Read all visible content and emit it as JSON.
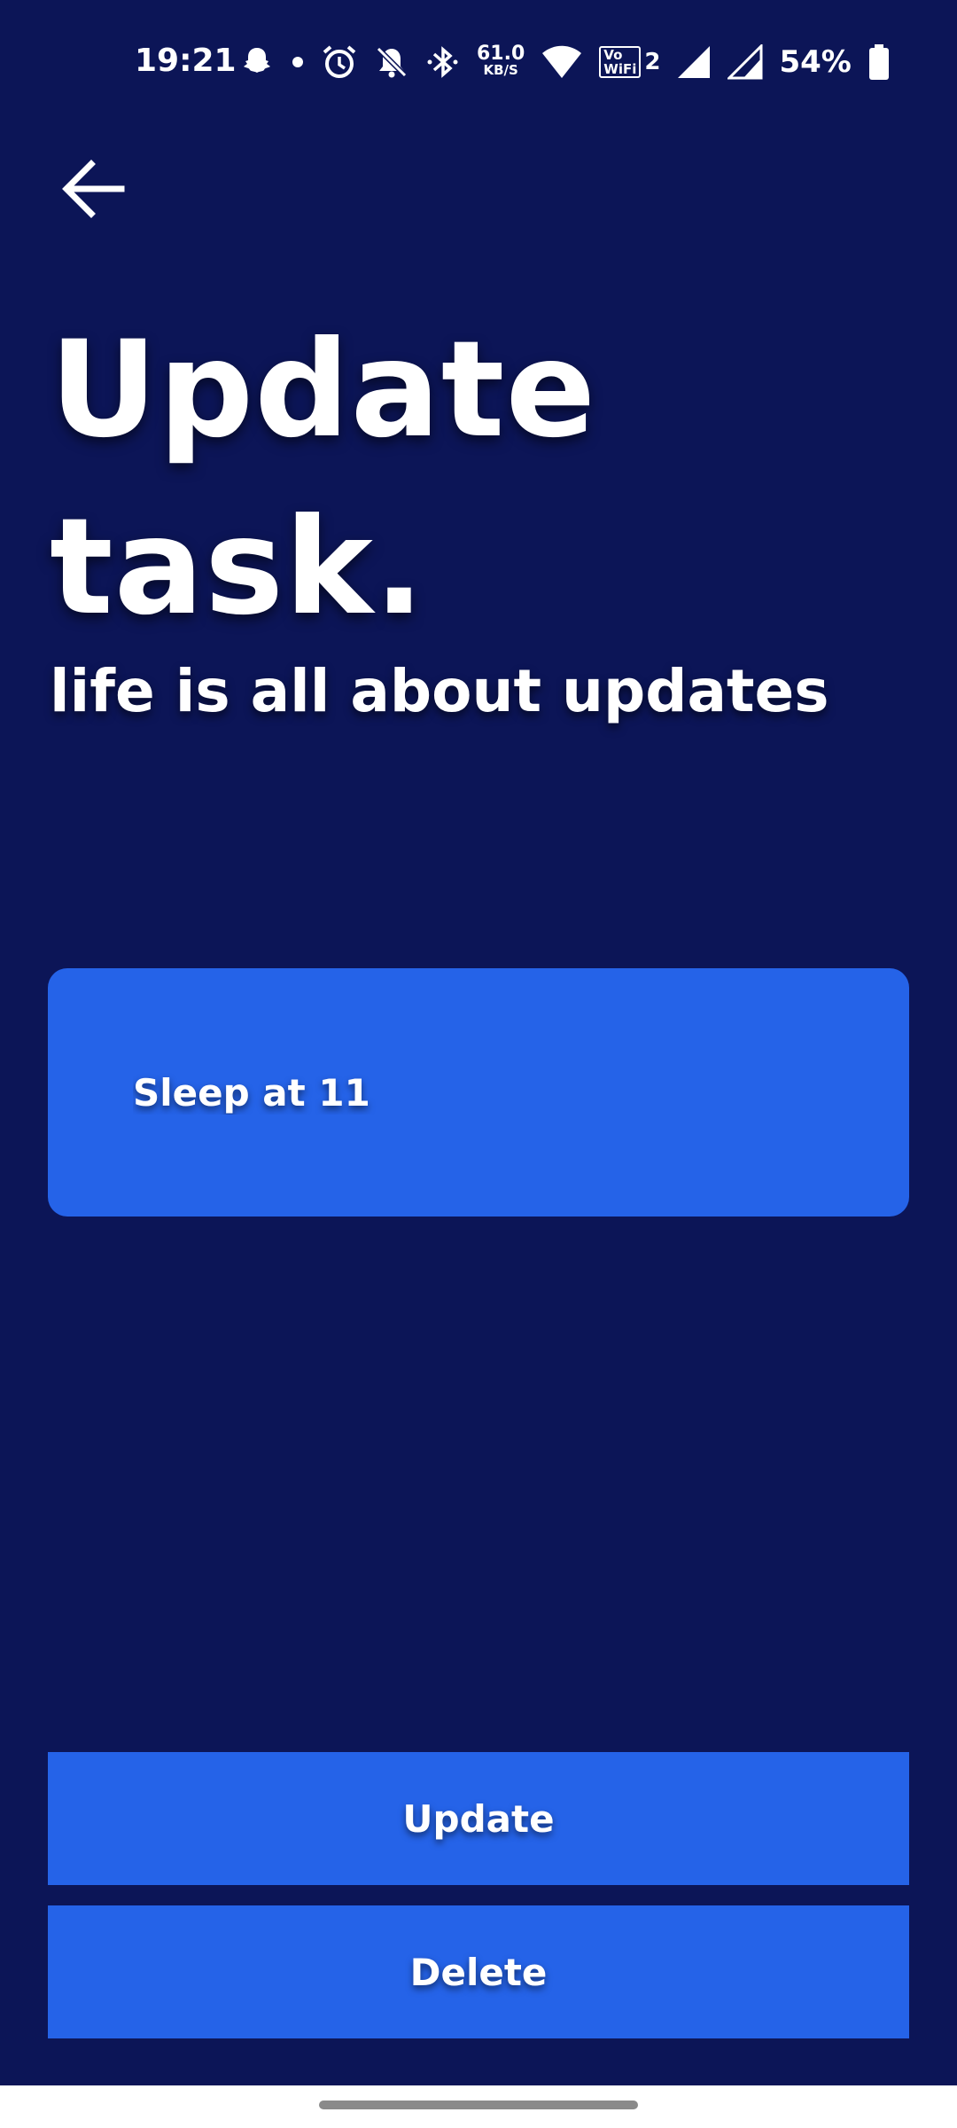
{
  "status_bar": {
    "time": "19:21",
    "net_speed_value": "61.0",
    "net_speed_unit": "KB/S",
    "vowifi_top": "Vo",
    "vowifi_bottom": "WiFi",
    "vowifi_sim": "2",
    "battery_percent": "54%",
    "icons": [
      "snapchat-icon",
      "dot-icon",
      "alarm-icon",
      "bell-off-icon",
      "bluetooth-icon",
      "wifi-icon",
      "vowifi-icon",
      "signal-icon",
      "signal-icon-2",
      "battery-icon"
    ]
  },
  "header": {
    "back_icon": "arrow-left-icon",
    "title": "Update task.",
    "subtitle": "life is all about updates"
  },
  "task": {
    "value": "Sleep at 11"
  },
  "actions": {
    "update_label": "Update",
    "delete_label": "Delete"
  },
  "colors": {
    "background": "#0c1557",
    "accent": "#2563e8",
    "text": "#ffffff"
  }
}
